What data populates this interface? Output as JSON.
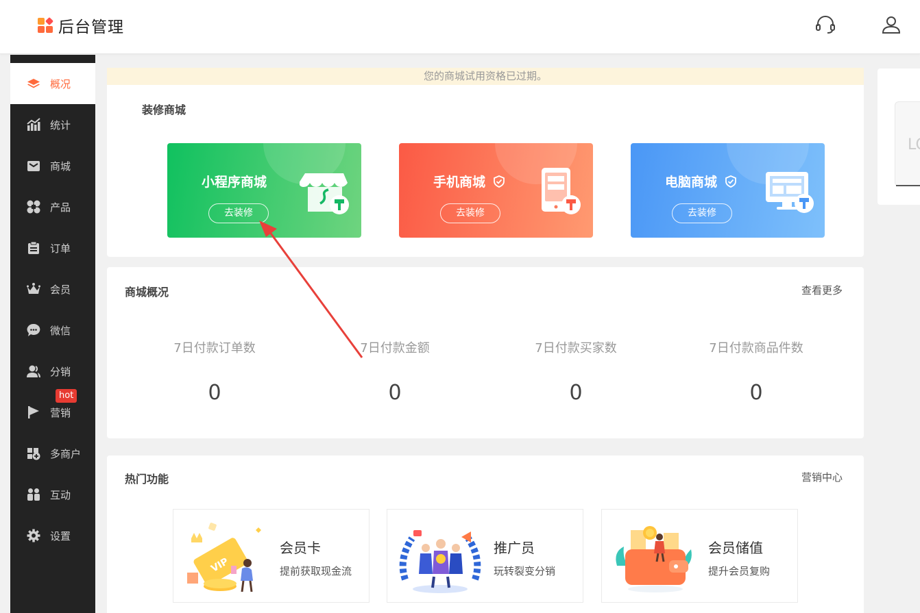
{
  "header": {
    "title": "后台管理",
    "icons": [
      "headset-icon",
      "user-icon"
    ]
  },
  "sidebar": {
    "items": [
      {
        "label": "概况",
        "icon": "layers-icon",
        "active": true
      },
      {
        "label": "统计",
        "icon": "chart-icon"
      },
      {
        "label": "商城",
        "icon": "mail-icon"
      },
      {
        "label": "产品",
        "icon": "grid-icon"
      },
      {
        "label": "订单",
        "icon": "clipboard-icon"
      },
      {
        "label": "会员",
        "icon": "crown-icon"
      },
      {
        "label": "微信",
        "icon": "chat-icon"
      },
      {
        "label": "分销",
        "icon": "users-icon"
      },
      {
        "label": "营销",
        "icon": "flag-icon",
        "badge": "hot"
      },
      {
        "label": "多商户",
        "icon": "shop-plus-icon"
      },
      {
        "label": "互动",
        "icon": "people-icon"
      },
      {
        "label": "设置",
        "icon": "gear-icon"
      }
    ]
  },
  "notice": "您的商城试用资格已过期。",
  "decorate": {
    "title": "装修商城",
    "cards": [
      {
        "title": "小程序商城",
        "button": "去装修",
        "color_from": "#10c15f",
        "color_to": "#6fd47f"
      },
      {
        "title": "手机商城",
        "button": "去装修",
        "color_from": "#fb5a45",
        "color_to": "#ff9a71"
      },
      {
        "title": "电脑商城",
        "button": "去装修",
        "color_from": "#4a97f6",
        "color_to": "#7ec0fb"
      }
    ]
  },
  "overview": {
    "title": "商城概况",
    "more": "查看更多",
    "stats": [
      {
        "label": "7日付款订单数",
        "value": "0"
      },
      {
        "label": "7日付款金额",
        "value": "0"
      },
      {
        "label": "7日付款买家数",
        "value": "0"
      },
      {
        "label": "7日付款商品件数",
        "value": "0"
      }
    ]
  },
  "hot": {
    "title": "热门功能",
    "more": "营销中心",
    "features": [
      {
        "title": "会员卡",
        "subtitle": "提前获取现金流"
      },
      {
        "title": "推广员",
        "subtitle": "玩转裂变分销"
      },
      {
        "title": "会员储值",
        "subtitle": "提升会员复购"
      }
    ]
  },
  "right_panel": {
    "text": "LO"
  },
  "colors": {
    "accent": "#ff6a3c",
    "sidebar_bg": "#232323",
    "notice_bg": "#fdf4dc",
    "hot_badge": "#e73b32",
    "arrow": "#e8403a"
  }
}
